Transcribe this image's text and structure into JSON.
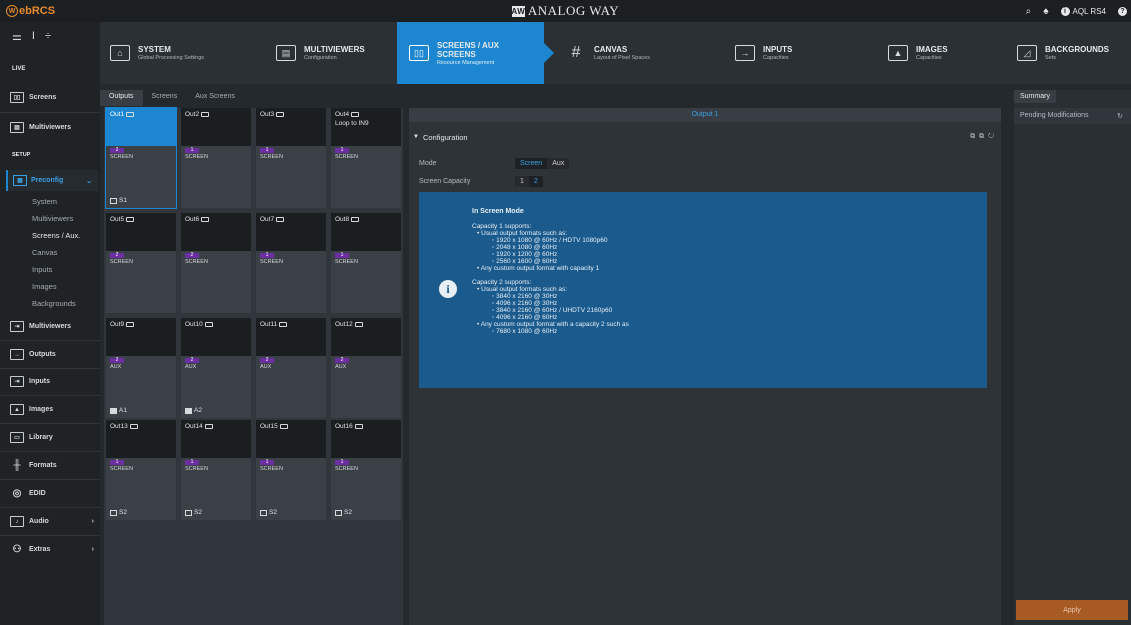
{
  "app": {
    "logo_w": "W",
    "logo_text": "ebRCS",
    "brand_mark": "AW",
    "brand": "ANALOG WAY",
    "user": "AQL RS4",
    "help_symbol": "?"
  },
  "live_label": "LIVE",
  "nav": [
    {
      "title": "SYSTEM",
      "sub": "Global Processing Settings",
      "icon": "system-icon",
      "glyph": "⌂"
    },
    {
      "title": "MULTIVIEWERS",
      "sub": "Configuration",
      "icon": "multiviewers-icon",
      "glyph": "▤"
    },
    {
      "title": "SCREENS / AUX SCREENS",
      "title_l1": "SCREENS / AUX",
      "title_l2": "SCREENS",
      "sub": "Resource Management",
      "icon": "screens-icon",
      "glyph": "▯▯"
    },
    {
      "title": "CANVAS",
      "sub": "Layout of Pixel Spaces",
      "icon": "canvas-icon",
      "glyph": "#"
    },
    {
      "title": "INPUTS",
      "sub": "Capacities",
      "icon": "inputs-icon",
      "glyph": "→"
    },
    {
      "title": "IMAGES",
      "sub": "Capacities",
      "icon": "images-icon",
      "glyph": "▲"
    },
    {
      "title": "BACKGROUNDS",
      "sub": "Sets",
      "icon": "backgrounds-icon",
      "glyph": "◿"
    }
  ],
  "sidebar": {
    "top_items": [
      {
        "label": "Screens",
        "glyph": "▯▯"
      },
      {
        "label": "Multiviewers",
        "glyph": "▤"
      }
    ],
    "setup_label": "SETUP",
    "preconfig_label": "Preconfig",
    "sub_items": [
      "System",
      "Multiviewers",
      "Screens / Aux.",
      "Canvas",
      "Inputs",
      "Images",
      "Backgrounds"
    ],
    "bottom_items": [
      {
        "label": "Multiviewers",
        "glyph": "⇥"
      },
      {
        "label": "Outputs",
        "glyph": "→"
      },
      {
        "label": "Inputs",
        "glyph": "⇥"
      },
      {
        "label": "Images",
        "glyph": "▲"
      },
      {
        "label": "Library",
        "glyph": "▭"
      },
      {
        "label": "Formats",
        "glyph": "╫"
      },
      {
        "label": "EDID",
        "glyph": "◎"
      },
      {
        "label": "Audio",
        "glyph": "♪"
      },
      {
        "label": "Extras",
        "glyph": "⚇"
      }
    ]
  },
  "subtabs": [
    "Outputs",
    "Screens",
    "Aux Screens"
  ],
  "outputs": [
    {
      "name": "Out1",
      "sub": "",
      "cap": "2",
      "kind": "SCREEN",
      "foot": "S1",
      "foot_type": "screen"
    },
    {
      "name": "Out2",
      "sub": "",
      "cap": "1",
      "kind": "SCREEN",
      "foot": "",
      "foot_type": ""
    },
    {
      "name": "Out3",
      "sub": "",
      "cap": "1",
      "kind": "SCREEN",
      "foot": "",
      "foot_type": ""
    },
    {
      "name": "Out4",
      "sub": "Loop to IN9",
      "cap": "1",
      "kind": "SCREEN",
      "foot": "",
      "foot_type": ""
    },
    {
      "name": "Out5",
      "sub": "",
      "cap": "2",
      "kind": "SCREEN",
      "foot": "",
      "foot_type": ""
    },
    {
      "name": "Out6",
      "sub": "",
      "cap": "2",
      "kind": "SCREEN",
      "foot": "",
      "foot_type": ""
    },
    {
      "name": "Out7",
      "sub": "",
      "cap": "1",
      "kind": "SCREEN",
      "foot": "",
      "foot_type": ""
    },
    {
      "name": "Out8",
      "sub": "",
      "cap": "1",
      "kind": "SCREEN",
      "foot": "",
      "foot_type": ""
    },
    {
      "name": "Out9",
      "sub": "",
      "cap": "2",
      "kind": "AUX",
      "foot": "A1",
      "foot_type": "aux"
    },
    {
      "name": "Out10",
      "sub": "",
      "cap": "2",
      "kind": "AUX",
      "foot": "A2",
      "foot_type": "aux"
    },
    {
      "name": "Out11",
      "sub": "",
      "cap": "2",
      "kind": "AUX",
      "foot": "",
      "foot_type": ""
    },
    {
      "name": "Out12",
      "sub": "",
      "cap": "2",
      "kind": "AUX",
      "foot": "",
      "foot_type": ""
    },
    {
      "name": "Out13",
      "sub": "",
      "cap": "1",
      "kind": "SCREEN",
      "foot": "S2",
      "foot_type": "screen"
    },
    {
      "name": "Out14",
      "sub": "",
      "cap": "1",
      "kind": "SCREEN",
      "foot": "S2",
      "foot_type": "screen"
    },
    {
      "name": "Out15",
      "sub": "",
      "cap": "1",
      "kind": "SCREEN",
      "foot": "S2",
      "foot_type": "screen"
    },
    {
      "name": "Out16",
      "sub": "",
      "cap": "1",
      "kind": "SCREEN",
      "foot": "S2",
      "foot_type": "screen"
    }
  ],
  "detail": {
    "title": "Output 1",
    "config_label": "Configuration",
    "tools": "⧉ ⧉ ↻",
    "mode_label": "Mode",
    "mode_options": [
      "Screen",
      "Aux"
    ],
    "mode_selected": "Screen",
    "capacity_label": "Screen Capacity",
    "capacity_options": [
      "1",
      "2"
    ],
    "capacity_selected": "2",
    "info": {
      "heading": "In Screen Mode",
      "cap1_title": "Capacity 1 supports:",
      "cap1_usual": "Usual output formats such as:",
      "cap1_formats": [
        "1920 x 1080 @ 60Hz / HDTV 1080p60",
        "2048 x 1080 @ 60Hz",
        "1920 x 1200 @ 60Hz",
        "2560 x 1600 @ 60Hz"
      ],
      "cap1_custom": "Any custom output format with capacity 1",
      "cap2_title": "Capacity 2 supports:",
      "cap2_usual": "Usual output formats such as:",
      "cap2_formats": [
        "3840 x 2160 @ 30Hz",
        "4096 x 2160 @ 30Hz",
        "3840 x 2160 @ 60Hz / UHDTV 2160p60",
        "4096 x 2160 @ 60Hz"
      ],
      "cap2_custom": "Any custom output format with a capacity 2 such as",
      "cap2_custom_example": "7680 x 1080 @ 60Hz"
    }
  },
  "summary": {
    "tab": "Summary",
    "pending": "Pending Modifications",
    "apply": "Apply"
  },
  "colors": {
    "accent": "#1c87d0",
    "capacity_badge": "#6b2fa1",
    "apply": "#a85a23",
    "logo": "#e78a2e"
  }
}
